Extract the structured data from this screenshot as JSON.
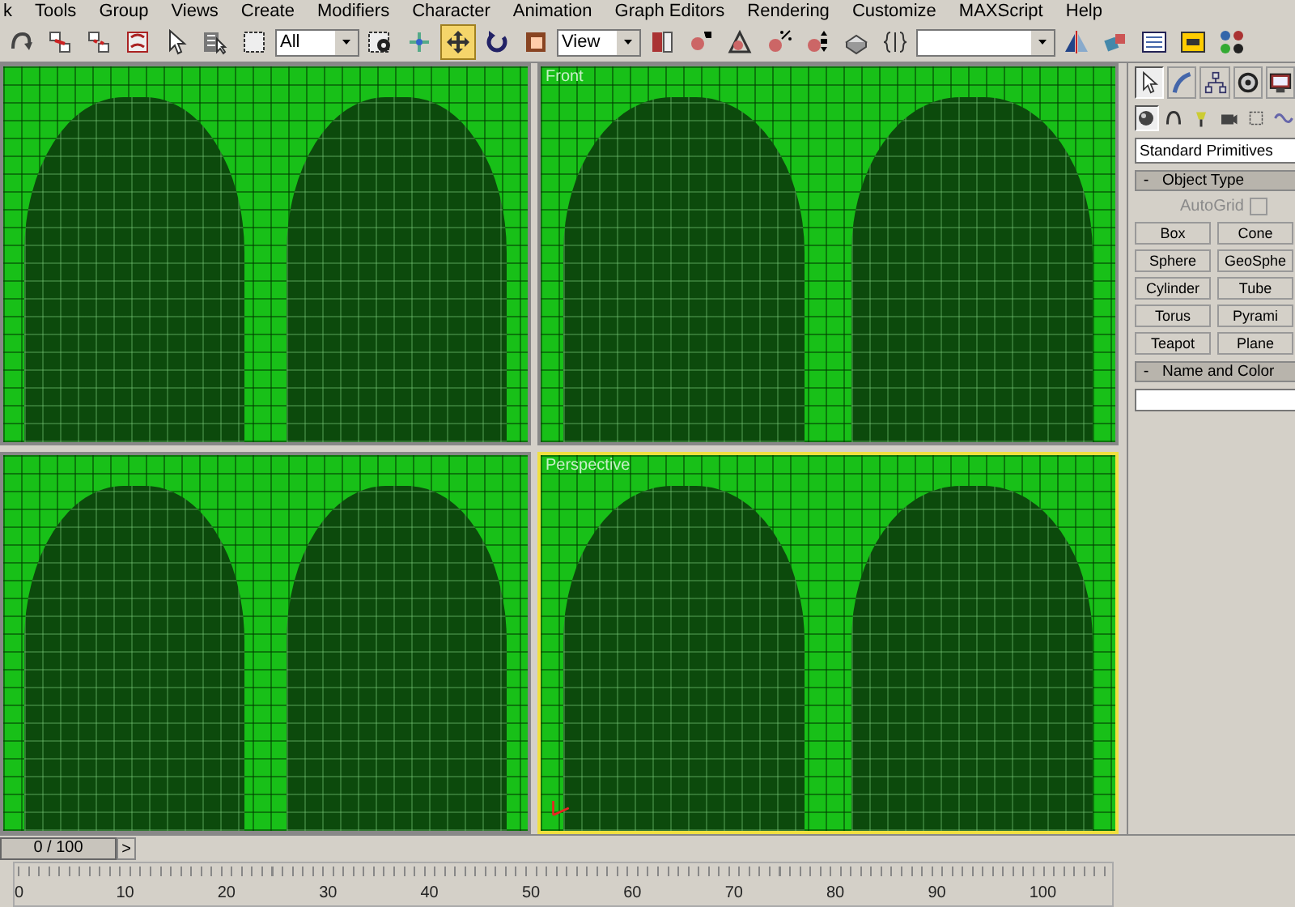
{
  "menu_bar": {
    "items": [
      "k",
      "Tools",
      "Group",
      "Views",
      "Create",
      "Modifiers",
      "Character",
      "Animation",
      "Graph Editors",
      "Rendering",
      "Customize",
      "MAXScript",
      "Help"
    ]
  },
  "toolbar": {
    "items": [
      {
        "kind": "tool",
        "selected": false
      },
      {
        "kind": "tool",
        "selected": false
      },
      {
        "kind": "tool",
        "selected": false
      },
      {
        "kind": "tool",
        "selected": false
      },
      {
        "kind": "tool",
        "selected": false
      },
      {
        "kind": "tool",
        "selected": false
      },
      {
        "kind": "tool",
        "selected": false
      },
      {
        "kind": "dropdown",
        "value": "All"
      },
      {
        "kind": "tool",
        "selected": false
      },
      {
        "kind": "tool",
        "selected": false
      },
      {
        "kind": "tool",
        "selected": true
      },
      {
        "kind": "tool",
        "selected": false
      },
      {
        "kind": "tool",
        "selected": false
      },
      {
        "kind": "dropdown",
        "value": "View"
      },
      {
        "kind": "tool",
        "selected": false
      },
      {
        "kind": "tool",
        "selected": false
      },
      {
        "kind": "tool",
        "selected": false
      },
      {
        "kind": "tool",
        "selected": false
      },
      {
        "kind": "tool",
        "selected": false
      },
      {
        "kind": "tool",
        "selected": false
      },
      {
        "kind": "tool",
        "selected": false
      },
      {
        "kind": "dropdown"
      },
      {
        "kind": "tool",
        "selected": false
      },
      {
        "kind": "tool",
        "selected": false
      },
      {
        "kind": "tool",
        "selected": false
      },
      {
        "kind": "tool",
        "selected": false
      },
      {
        "kind": "tool",
        "selected": false
      }
    ]
  },
  "viewports": [
    {
      "active": false
    },
    {
      "label": "Front",
      "active": false
    },
    {
      "active": false
    },
    {
      "label": "Perspective",
      "active": true
    }
  ],
  "command_panel": {
    "tabs": [
      {
        "selected": true
      },
      {
        "selected": false
      },
      {
        "selected": false
      },
      {
        "selected": false
      },
      {
        "selected": false
      }
    ],
    "categories": [
      {
        "selected": true
      },
      {
        "selected": false
      },
      {
        "selected": false
      },
      {
        "selected": false
      },
      {
        "selected": false
      },
      {
        "selected": false
      }
    ],
    "type_dropdown": "Standard Primitives",
    "rollouts": [
      {
        "kind": "object_type",
        "sign": "-",
        "title": "Object Type",
        "autogrid": {
          "label": "AutoGrid",
          "checked": false,
          "disabled": true
        },
        "buttons": [
          "Box",
          "Cone",
          "Sphere",
          "GeoSphe",
          "Cylinder",
          "Tube",
          "Torus",
          "Pyrami",
          "Teapot",
          "Plane"
        ]
      },
      {
        "kind": "name_color",
        "sign": "-",
        "title": "Name and Color"
      }
    ]
  },
  "timeline": {
    "position": "0 / 100",
    "next_button": ">",
    "ruler_labels": [
      "0",
      "10",
      "20",
      "30",
      "40",
      "50",
      "60",
      "70",
      "80",
      "90",
      "100"
    ]
  }
}
